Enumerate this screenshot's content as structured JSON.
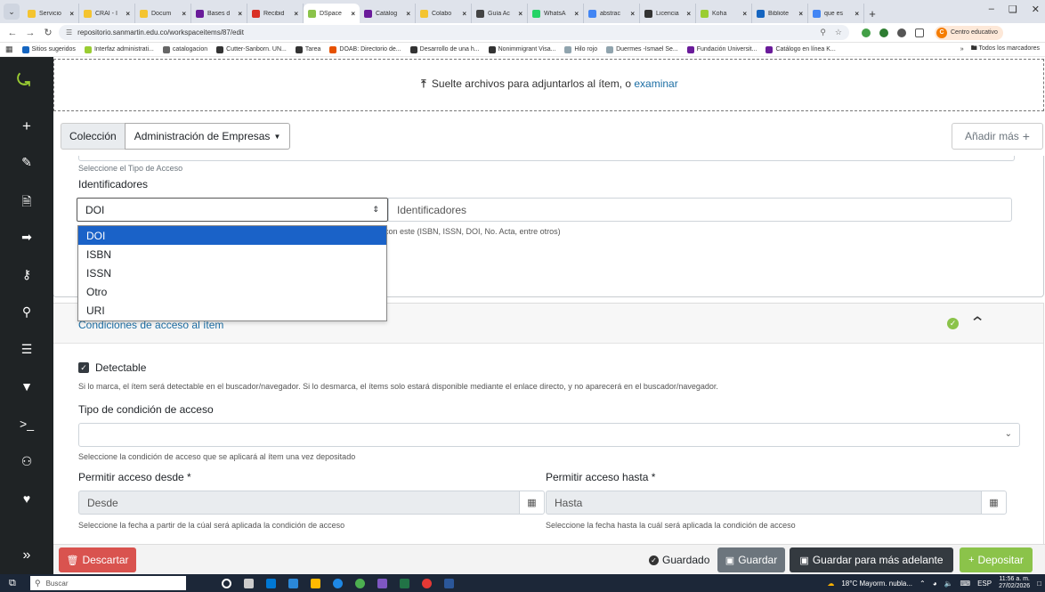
{
  "browser": {
    "tabs": [
      {
        "label": "Servicio",
        "fav": "#f4c430"
      },
      {
        "label": "CRAI - I",
        "fav": "#f4c430"
      },
      {
        "label": "Docum",
        "fav": "#f4c430"
      },
      {
        "label": "Bases d",
        "fav": "#6a1b9a"
      },
      {
        "label": "Recibid",
        "fav": "#d93025"
      },
      {
        "label": "DSpace",
        "fav": "#8bc34a",
        "active": true
      },
      {
        "label": "Catálog",
        "fav": "#6a1b9a"
      },
      {
        "label": "Colabo",
        "fav": "#f4c430"
      },
      {
        "label": "Guía Ac",
        "fav": "#444444"
      },
      {
        "label": "WhatsA",
        "fav": "#25d366"
      },
      {
        "label": "abstrac",
        "fav": "#4285f4"
      },
      {
        "label": "Licencia",
        "fav": "#333333"
      },
      {
        "label": "Koha",
        "fav": "#9acd32"
      },
      {
        "label": "Bibliote",
        "fav": "#1565c0"
      },
      {
        "label": "que es",
        "fav": "#4285f4"
      }
    ],
    "url": "repositorio.sanmartin.edu.co/workspaceitems/87/edit",
    "profile_label": "Centro educativo",
    "profile_initial": "C",
    "bookmarks": [
      {
        "label": "Sitios sugeridos",
        "color": "#1565c0"
      },
      {
        "label": "Interfaz administrati...",
        "color": "#9acd32"
      },
      {
        "label": "catalogacion",
        "color": "#666666"
      },
      {
        "label": "Cutter-Sanborn. UN...",
        "color": "#333333"
      },
      {
        "label": "Tarea",
        "color": "#333333"
      },
      {
        "label": "DOAB: Directorio de...",
        "color": "#e65100"
      },
      {
        "label": "Desarrollo de una h...",
        "color": "#333333"
      },
      {
        "label": "Nonimmigrant Visa...",
        "color": "#333333"
      },
      {
        "label": "Hilo rojo",
        "color": "#90a4ae"
      },
      {
        "label": "Duermes -Ismael Se...",
        "color": "#90a4ae"
      },
      {
        "label": "Fundación Universit...",
        "color": "#6a1b9a"
      },
      {
        "label": "Catálogo en línea K...",
        "color": "#6a1b9a"
      }
    ],
    "bookmarks_all": "Todos los marcadores"
  },
  "sidebar": {
    "icons": [
      "dspace-logo-icon",
      "plus-icon",
      "pencil-icon",
      "file-import-icon",
      "file-export-icon",
      "key-icon",
      "search-icon",
      "list-icon",
      "filter-icon",
      "terminal-icon",
      "user-check-icon",
      "heartbeat-icon",
      "expand-icon"
    ]
  },
  "upload": {
    "text": "Suelte archivos para adjuntarlos al ítem, o",
    "link": "examinar"
  },
  "collection": {
    "label": "Colección",
    "value": "Administración de Empresas",
    "add_more": "Añadir más"
  },
  "form": {
    "access_type_hint": "Seleccione el Tipo de Acceso",
    "identifiers_label": "Identificadores",
    "identifier_type_selected": "DOI",
    "identifier_placeholder": "Identificadores",
    "identifier_hint": "con este (ISBN, ISSN, DOI, No. Acta, entre otros)",
    "dropdown_options": [
      "DOI",
      "ISBN",
      "ISSN",
      "Otro",
      "URI"
    ]
  },
  "access": {
    "title": "Condiciones de acceso al ítem",
    "discoverable_label": "Detectable",
    "discoverable_checked": true,
    "discoverable_hint": "Si lo marca, el ítem será detectable en el buscador/navegador. Si lo desmarca, el ítems solo estará disponible mediante el enlace directo, y no aparecerá en el buscador/navegador.",
    "condition_label": "Tipo de condición de acceso",
    "condition_value": "",
    "condition_hint": "Seleccione la condición de acceso que se aplicará al ítem una vez depositado",
    "from_label": "Permitir acceso desde *",
    "from_placeholder": "Desde",
    "from_hint": "Seleccione la fecha a partir de la cúal será aplicada la condición de acceso",
    "to_label": "Permitir acceso hasta *",
    "to_placeholder": "Hasta",
    "to_hint": "Seleccione la fecha hasta la cuál será aplicada la condición de acceso"
  },
  "footer": {
    "discard": "Descartar",
    "saved_status": "Guardado",
    "save": "Guardar",
    "save_later": "Guardar para más adelante",
    "deposit": "Depositar"
  },
  "taskbar": {
    "search_placeholder": "Buscar",
    "weather": "18°C Mayorm. nubla...",
    "language": "ESP",
    "time": "11:56 a. m.",
    "date": "27/02/2026"
  },
  "colors": {
    "dspace_green": "#8bc34a",
    "danger": "#d9534f",
    "link": "#1c6ea4",
    "selected_option": "#1a62c8"
  }
}
